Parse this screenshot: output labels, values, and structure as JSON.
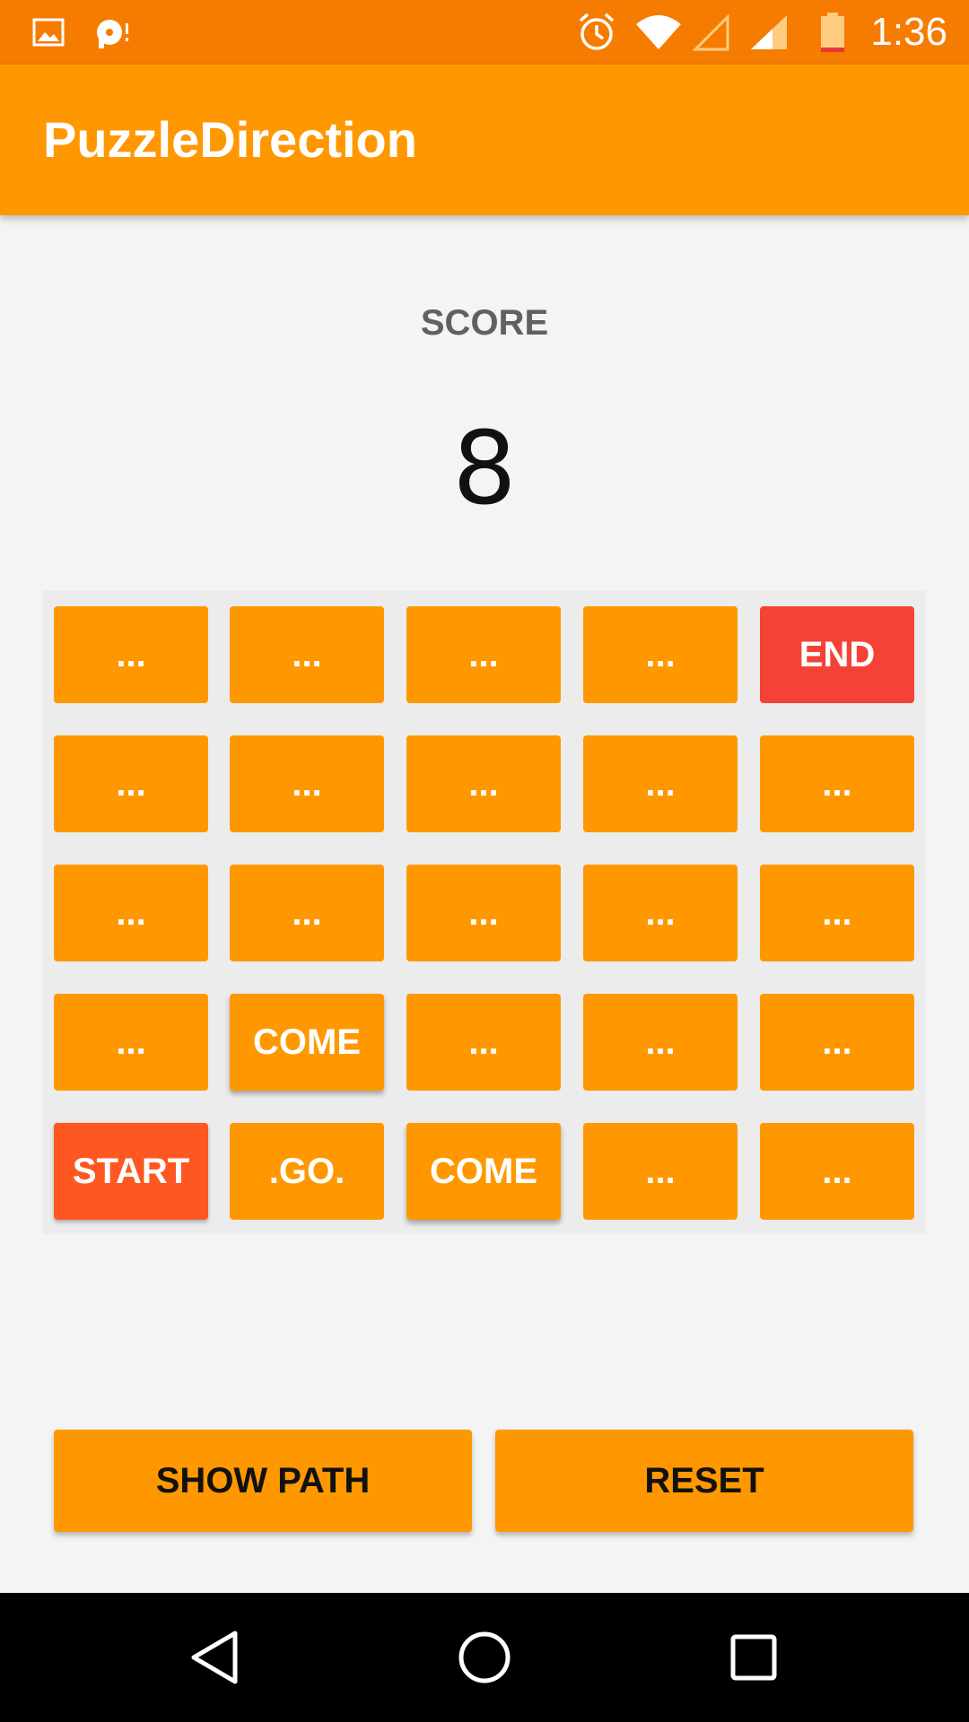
{
  "status_bar": {
    "time": "1:36",
    "icons": [
      "image-icon",
      "media-icon",
      "alarm-icon",
      "wifi-icon",
      "signal-empty-icon",
      "signal-icon",
      "battery-low-icon"
    ],
    "background": "#f57c00"
  },
  "app_bar": {
    "title": "PuzzleDirection",
    "background": "#ff9800"
  },
  "score": {
    "label": "SCORE",
    "value": "8"
  },
  "grid": {
    "rows": [
      [
        "...",
        "...",
        "...",
        "...",
        "END"
      ],
      [
        "...",
        "...",
        "...",
        "...",
        "..."
      ],
      [
        "...",
        "...",
        "...",
        "...",
        "..."
      ],
      [
        "...",
        "COME",
        "...",
        "...",
        "..."
      ],
      [
        "START",
        ".GO.",
        "COME",
        "...",
        "..."
      ]
    ],
    "colors": {
      "cell": "#ff9800",
      "end": "#f44336",
      "start": "#ff5722"
    }
  },
  "actions": {
    "show_path_label": "SHOW PATH",
    "reset_label": "RESET"
  },
  "nav_bar": {
    "icons": [
      "back-icon",
      "home-icon",
      "recents-icon"
    ]
  }
}
